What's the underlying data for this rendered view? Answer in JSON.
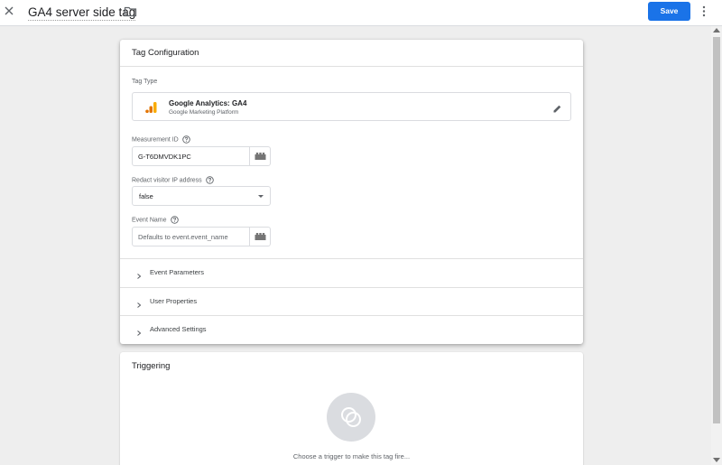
{
  "header": {
    "tag_name": "GA4 server side tag",
    "save_label": "Save",
    "close_icon": "close-icon",
    "folder_icon": "folder-icon",
    "more_icon": "more-vert-icon",
    "accent_color": "#1a73e8"
  },
  "tag_configuration": {
    "title": "Tag Configuration",
    "tag_type": {
      "label": "Tag Type",
      "name": "Google Analytics: GA4",
      "subtitle": "Google Marketing Platform",
      "icon": "google-analytics-icon",
      "edit_icon": "pencil-icon"
    },
    "measurement_id": {
      "label": "Measurement ID",
      "value": "G-T6DMVDK1PC",
      "variable_icon": "lego-brick-icon"
    },
    "redact_ip": {
      "label": "Redact visitor IP address",
      "value": "false"
    },
    "event_name": {
      "label": "Event Name",
      "value": "",
      "placeholder": "Defaults to event.event_name",
      "variable_icon": "lego-brick-icon"
    },
    "sections": [
      {
        "label": "Event Parameters"
      },
      {
        "label": "User Properties"
      },
      {
        "label": "Advanced Settings"
      }
    ]
  },
  "triggering": {
    "title": "Triggering",
    "hint": "Choose a trigger to make this tag fire...",
    "icon": "trigger-icon"
  }
}
